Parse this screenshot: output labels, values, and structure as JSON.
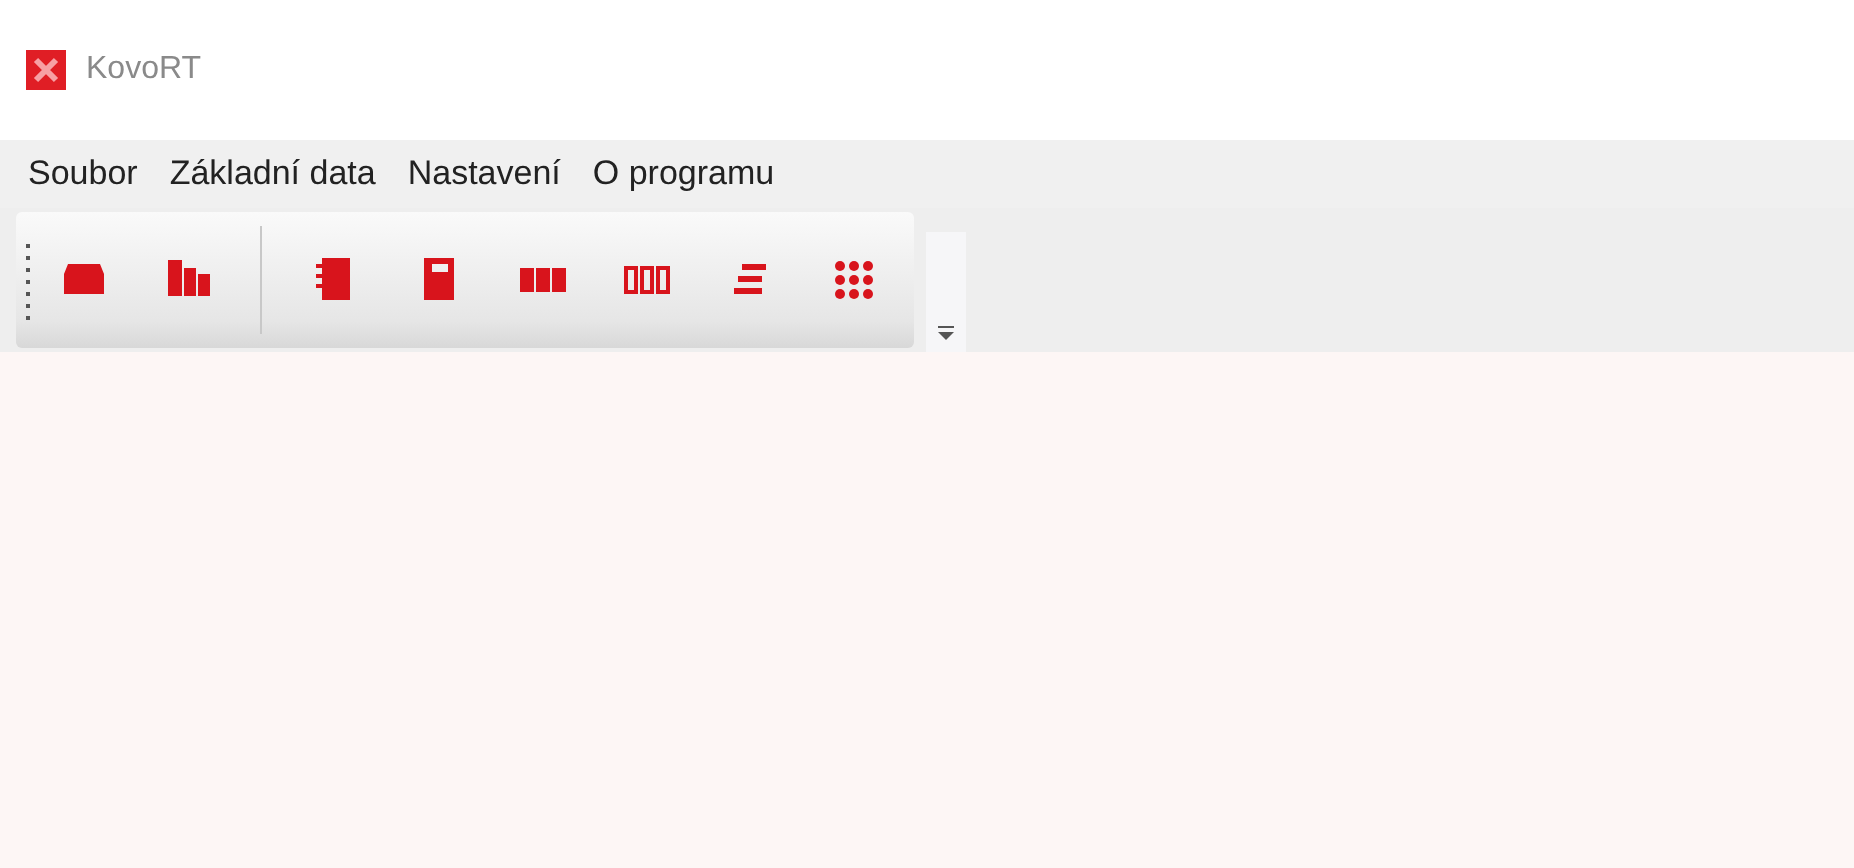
{
  "window": {
    "title": "KovoRT"
  },
  "menu": [
    {
      "label": "Soubor"
    },
    {
      "label": "Základní data"
    },
    {
      "label": "Nastavení"
    },
    {
      "label": "O programu"
    }
  ]
}
